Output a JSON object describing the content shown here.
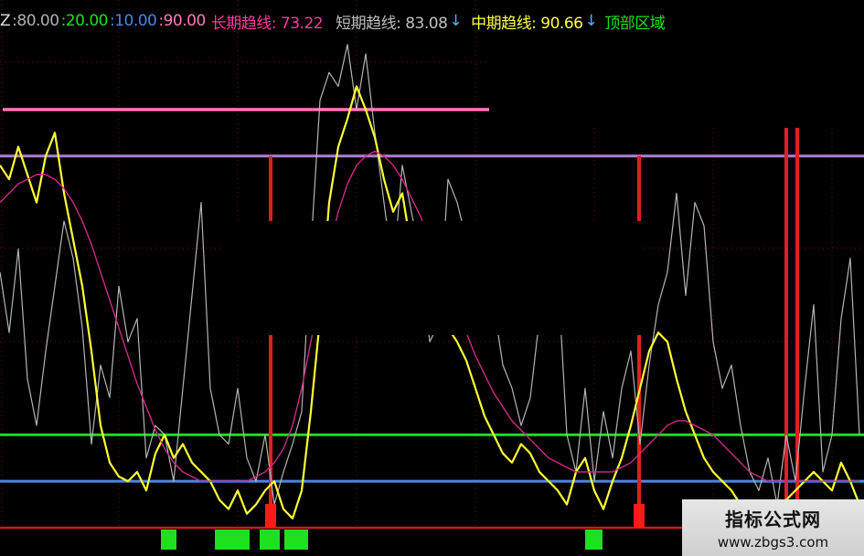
{
  "legend": {
    "indicator_name": "Z",
    "items": [
      {
        "label": ":80.00",
        "color": "#b0b0b0"
      },
      {
        "label": ":20.00",
        "color": "#22dd22"
      },
      {
        "label": ":10.00",
        "color": "#4a86e8"
      },
      {
        "label": ":90.00",
        "color": "#ff7ab8"
      },
      {
        "label": "长期趋线: 73.22",
        "color": "#ff3aa0"
      },
      {
        "label": "短期趋线: 83.08",
        "color": "#c0c0c0"
      },
      {
        "label": "↓",
        "color": "#4ab0ff"
      },
      {
        "label": "中期趋线: 90.66",
        "color": "#ffff44"
      },
      {
        "label": "↓",
        "color": "#4ab0ff"
      },
      {
        "label": "顶部区域",
        "color": "#22dd22"
      }
    ]
  },
  "watermark": {
    "title": "指标公式网",
    "url": "www.zbgs3.com"
  },
  "chart_data": {
    "type": "line",
    "ylim": [
      -10,
      110
    ],
    "reference_lines": [
      {
        "name": "90.00",
        "value": 90,
        "color": "#ff7ab8"
      },
      {
        "name": "80.00",
        "value": 80,
        "color": "#b57fd6"
      },
      {
        "name": "20.00",
        "value": 20,
        "color": "#22dd22"
      },
      {
        "name": "10.00",
        "value": 10,
        "color": "#4a86e8"
      },
      {
        "name": "0",
        "value": 0,
        "color": "#d01818"
      }
    ],
    "x": [
      0,
      10,
      20,
      30,
      40,
      50,
      60,
      70,
      80,
      90,
      100,
      110,
      120,
      130,
      140,
      150,
      160,
      170,
      180,
      190,
      200,
      210,
      220,
      230,
      240,
      250,
      260,
      270,
      280,
      290,
      300,
      310,
      320,
      330,
      340,
      350,
      360,
      370,
      380,
      390,
      400,
      410,
      420,
      430,
      440,
      450,
      460,
      470,
      480,
      490,
      500,
      510,
      520,
      530,
      540,
      550,
      560,
      570,
      580,
      590,
      600,
      610,
      620,
      630,
      640,
      650,
      660,
      670,
      680,
      690,
      700,
      710,
      720,
      730,
      740,
      750,
      760,
      770,
      780,
      790,
      800,
      810,
      820,
      830,
      840,
      850,
      860,
      870,
      880,
      890,
      900,
      910,
      920,
      930,
      940
    ],
    "series": [
      {
        "name": "短期趋线",
        "color": "#b4b4b4",
        "width": 1.2,
        "values": [
          55,
          42,
          60,
          32,
          22,
          38,
          52,
          66,
          58,
          43,
          18,
          35,
          28,
          52,
          40,
          45,
          15,
          22,
          20,
          10,
          30,
          50,
          70,
          30,
          20,
          18,
          30,
          15,
          10,
          20,
          5,
          12,
          18,
          25,
          60,
          92,
          98,
          95,
          104,
          90,
          102,
          85,
          70,
          55,
          78,
          68,
          58,
          40,
          44,
          75,
          70,
          62,
          65,
          58,
          48,
          35,
          30,
          22,
          28,
          45,
          48,
          55,
          20,
          12,
          30,
          10,
          25,
          15,
          30,
          38,
          18,
          35,
          48,
          55,
          72,
          50,
          70,
          65,
          40,
          30,
          35,
          22,
          12,
          8,
          15,
          5,
          20,
          10,
          30,
          48,
          12,
          20,
          45,
          58,
          20
        ]
      },
      {
        "name": "中期趋线",
        "color": "#ffff33",
        "width": 2.2,
        "values": [
          78,
          75,
          82,
          76,
          70,
          80,
          85,
          72,
          62,
          52,
          38,
          22,
          14,
          11,
          10,
          12,
          8,
          16,
          20,
          15,
          18,
          14,
          12,
          10,
          6,
          4,
          8,
          3,
          5,
          8,
          10,
          4,
          2,
          8,
          25,
          45,
          70,
          82,
          88,
          95,
          90,
          84,
          75,
          68,
          72,
          60,
          55,
          48,
          45,
          43,
          40,
          36,
          30,
          24,
          20,
          16,
          14,
          18,
          16,
          12,
          10,
          8,
          5,
          12,
          15,
          8,
          4,
          10,
          15,
          22,
          30,
          38,
          42,
          40,
          32,
          25,
          20,
          15,
          12,
          10,
          8,
          5,
          2,
          4,
          3,
          5,
          6,
          8,
          10,
          12,
          10,
          8,
          14,
          10,
          5
        ]
      },
      {
        "name": "长期趋线",
        "color": "#cc2a88",
        "width": 1.4,
        "values": [
          70,
          72,
          74,
          75,
          76,
          76,
          75,
          73,
          70,
          66,
          61,
          55,
          49,
          43,
          37,
          31,
          26,
          21,
          17,
          14,
          12,
          11,
          10,
          10,
          10,
          10,
          10,
          10,
          11,
          12,
          14,
          17,
          22,
          30,
          40,
          50,
          60,
          68,
          74,
          78,
          80,
          81,
          80,
          78,
          75,
          71,
          67,
          62,
          57,
          52,
          47,
          42,
          37,
          33,
          29,
          26,
          23,
          21,
          19,
          17,
          15,
          14,
          13,
          12,
          12,
          12,
          12,
          12,
          13,
          14,
          16,
          18,
          20,
          22,
          23,
          23,
          22,
          21,
          20,
          18,
          16,
          14,
          12,
          11,
          10,
          10,
          10,
          10,
          10,
          10,
          10,
          10,
          10,
          10,
          10
        ]
      }
    ],
    "bars": [
      {
        "x": 296,
        "top": 20,
        "color": "#e02020"
      },
      {
        "x": 699,
        "top": 20,
        "color": "#e02020"
      },
      {
        "x": 860,
        "top": 50,
        "color": "#e02020"
      },
      {
        "x": 872,
        "top": 53,
        "color": "#e02020"
      }
    ],
    "lower_blocks": [
      {
        "x1": 176,
        "x2": 193,
        "color": "#1ee01e"
      },
      {
        "x1": 235,
        "x2": 273,
        "color": "#1ee01e"
      },
      {
        "x1": 284,
        "x2": 306,
        "color": "#1ee01e"
      },
      {
        "x1": 311,
        "x2": 337,
        "color": "#1ee01e"
      },
      {
        "x1": 640,
        "x2": 659,
        "color": "#1ee01e"
      },
      {
        "x1": 290,
        "x2": 302,
        "color": "#ff1a1a",
        "upper": true
      },
      {
        "x1": 693,
        "x2": 705,
        "color": "#ff1a1a",
        "upper": true
      }
    ]
  }
}
